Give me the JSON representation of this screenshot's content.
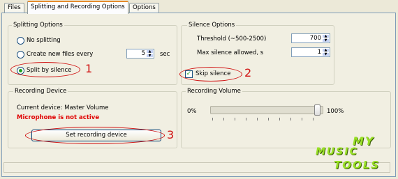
{
  "tabs": [
    "Files",
    "Splitting and Recording Options",
    "Options"
  ],
  "splitting": {
    "legend": "Splitting Options",
    "options": [
      "No splitting",
      "Create new files every",
      "Split by silence"
    ],
    "selected_index": 2,
    "every_value": "5",
    "every_unit": "sec"
  },
  "silence": {
    "legend": "Silence Options",
    "threshold_label": "Threshold (~500-2500)",
    "threshold_value": "700",
    "max_silence_label": "Max silence allowed, s",
    "max_silence_value": "1",
    "skip_label": "Skip silence",
    "skip_checked": true
  },
  "recording_device": {
    "legend": "Recording Device",
    "current_device": "Current device: Master Volume",
    "warning": "Microphone is not active",
    "set_button": "Set recording device",
    "warning_color": "#e00000"
  },
  "recording_volume": {
    "legend": "Recording Volume",
    "min_label": "0%",
    "max_label": "100%",
    "level": 1.0
  },
  "annotations": [
    "1",
    "2",
    "3"
  ],
  "logo": {
    "line1": "MY",
    "line2": "MUSIC",
    "line3": "TOOLS"
  }
}
